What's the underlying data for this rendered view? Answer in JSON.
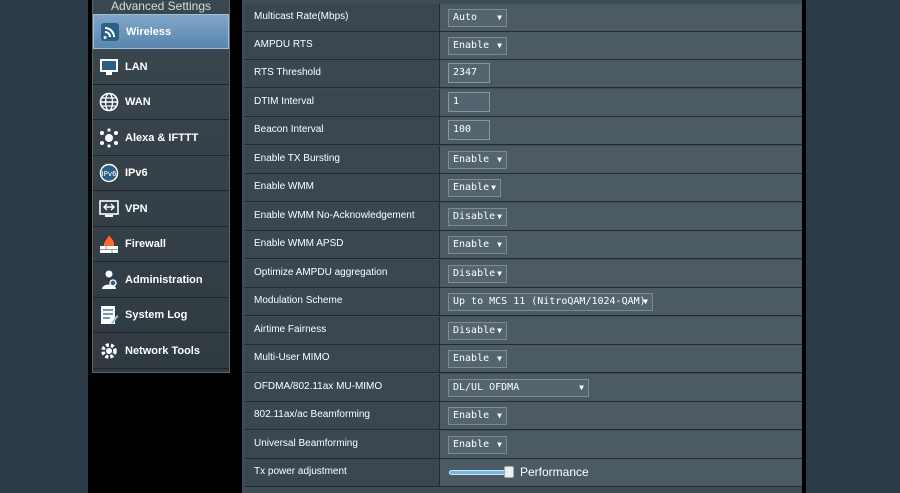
{
  "sidebar": {
    "header": "Advanced Settings",
    "items": [
      {
        "label": "Wireless",
        "icon": "wifi-icon",
        "active": true
      },
      {
        "label": "LAN",
        "icon": "monitor-icon"
      },
      {
        "label": "WAN",
        "icon": "globe-icon"
      },
      {
        "label": "Alexa & IFTTT",
        "icon": "alexa-icon"
      },
      {
        "label": "IPv6",
        "icon": "ipv6-icon"
      },
      {
        "label": "VPN",
        "icon": "vpn-icon"
      },
      {
        "label": "Firewall",
        "icon": "firewall-icon"
      },
      {
        "label": "Administration",
        "icon": "admin-icon"
      },
      {
        "label": "System Log",
        "icon": "log-icon"
      },
      {
        "label": "Network Tools",
        "icon": "tools-icon"
      }
    ]
  },
  "settings": [
    {
      "label": "Multicast Rate(Mbps)",
      "type": "select",
      "value": "Auto"
    },
    {
      "label": "AMPDU RTS",
      "type": "select",
      "value": "Enable"
    },
    {
      "label": "RTS Threshold",
      "type": "input",
      "value": "2347"
    },
    {
      "label": "DTIM Interval",
      "type": "input",
      "value": "1"
    },
    {
      "label": "Beacon Interval",
      "type": "input",
      "value": "100"
    },
    {
      "label": "Enable TX Bursting",
      "type": "select",
      "value": "Enable"
    },
    {
      "label": "Enable WMM",
      "type": "select",
      "value": "Enable"
    },
    {
      "label": "Enable WMM No-Acknowledgement",
      "type": "select",
      "value": "Disable"
    },
    {
      "label": "Enable WMM APSD",
      "type": "select",
      "value": "Enable"
    },
    {
      "label": "Optimize AMPDU aggregation",
      "type": "select",
      "value": "Disable"
    },
    {
      "label": "Modulation Scheme",
      "type": "select",
      "value": "Up to MCS 11 (NitroQAM/1024-QAM)"
    },
    {
      "label": "Airtime Fairness",
      "type": "select",
      "value": "Disable"
    },
    {
      "label": "Multi-User MIMO",
      "type": "select",
      "value": "Enable"
    },
    {
      "label": "OFDMA/802.11ax MU-MIMO",
      "type": "select",
      "value": "DL/UL OFDMA"
    },
    {
      "label": "802.11ax/ac Beamforming",
      "type": "select",
      "value": "Enable"
    },
    {
      "label": "Universal Beamforming",
      "type": "select",
      "value": "Enable"
    },
    {
      "label": "Tx power adjustment",
      "type": "slider",
      "value": "Performance"
    }
  ],
  "colors": {
    "accent": "#5a86ad",
    "slider": "#6fb6e6"
  }
}
